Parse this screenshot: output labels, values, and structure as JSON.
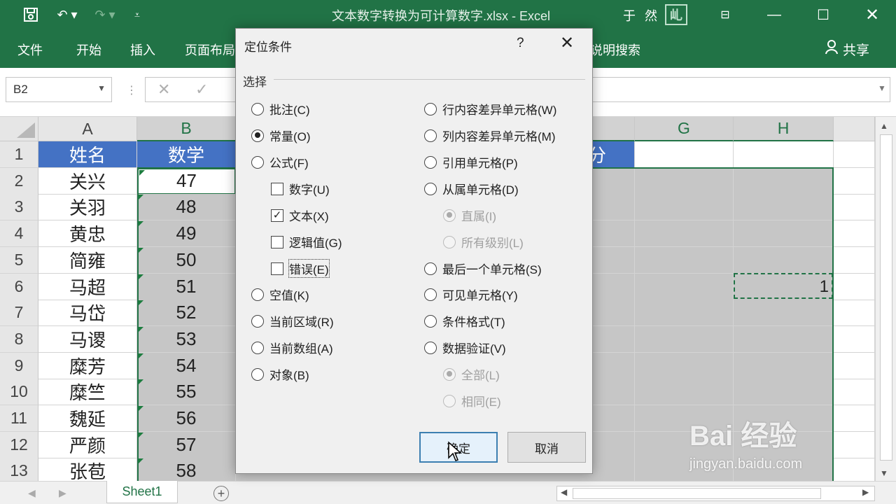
{
  "window": {
    "title": "文本数字转换为可计算数字.xlsx  -  Excel",
    "user": "于 然",
    "user_badge": "乢",
    "icons": [
      "save-icon",
      "undo-icon",
      "redo-icon",
      "customize-icon",
      "ribbon-display-icon",
      "minimize-icon",
      "maximize-icon",
      "close-icon"
    ]
  },
  "ribbon": {
    "tabs": [
      "文件",
      "开始",
      "插入",
      "页面布局"
    ],
    "search_tail": "说明搜索",
    "share_label": "共享"
  },
  "formula_bar": {
    "name_box": "B2",
    "value": ""
  },
  "grid": {
    "column_headers": [
      "A",
      "B",
      "G",
      "H"
    ],
    "row_numbers": [
      "1",
      "2",
      "3",
      "4",
      "5",
      "6",
      "7",
      "8",
      "9",
      "10",
      "11",
      "12",
      "13"
    ],
    "header_row": [
      "姓名",
      "数学"
    ],
    "header_tail": "分",
    "names": [
      "关兴",
      "关羽",
      "黄忠",
      "简雍",
      "马超",
      "马岱",
      "马谡",
      "糜芳",
      "糜竺",
      "魏延",
      "严颜",
      "张苞"
    ],
    "math": [
      "47",
      "48",
      "49",
      "50",
      "51",
      "52",
      "53",
      "54",
      "55",
      "56",
      "57",
      "58"
    ],
    "copied_cell_value": "1"
  },
  "sheet_tabs": {
    "active": "Sheet1"
  },
  "dialog": {
    "title": "定位条件",
    "help": "?",
    "close": "✕",
    "group_label": "选择",
    "left_options": [
      {
        "label": "批注(C)",
        "type": "radio",
        "checked": false
      },
      {
        "label": "常量(O)",
        "type": "radio",
        "checked": true
      },
      {
        "label": "公式(F)",
        "type": "radio",
        "checked": false
      },
      {
        "label": "数字(U)",
        "type": "checkbox",
        "checked": false
      },
      {
        "label": "文本(X)",
        "type": "checkbox",
        "checked": true
      },
      {
        "label": "逻辑值(G)",
        "type": "checkbox",
        "checked": false
      },
      {
        "label": "错误(E)",
        "type": "checkbox",
        "checked": false
      },
      {
        "label": "空值(K)",
        "type": "radio",
        "checked": false
      },
      {
        "label": "当前区域(R)",
        "type": "radio",
        "checked": false
      },
      {
        "label": "当前数组(A)",
        "type": "radio",
        "checked": false
      },
      {
        "label": "对象(B)",
        "type": "radio",
        "checked": false
      }
    ],
    "right_options": [
      {
        "label": "行内容差异单元格(W)",
        "type": "radio",
        "checked": false,
        "disabled": false
      },
      {
        "label": "列内容差异单元格(M)",
        "type": "radio",
        "checked": false,
        "disabled": false
      },
      {
        "label": "引用单元格(P)",
        "type": "radio",
        "checked": false,
        "disabled": false
      },
      {
        "label": "从属单元格(D)",
        "type": "radio",
        "checked": false,
        "disabled": false
      },
      {
        "label": "直属(I)",
        "type": "radio",
        "checked": true,
        "disabled": true
      },
      {
        "label": "所有级别(L)",
        "type": "radio",
        "checked": false,
        "disabled": true
      },
      {
        "label": "最后一个单元格(S)",
        "type": "radio",
        "checked": false,
        "disabled": false
      },
      {
        "label": "可见单元格(Y)",
        "type": "radio",
        "checked": false,
        "disabled": false
      },
      {
        "label": "条件格式(T)",
        "type": "radio",
        "checked": false,
        "disabled": false
      },
      {
        "label": "数据验证(V)",
        "type": "radio",
        "checked": false,
        "disabled": false
      },
      {
        "label": "全部(L)",
        "type": "radio",
        "checked": true,
        "disabled": true
      },
      {
        "label": "相同(E)",
        "type": "radio",
        "checked": false,
        "disabled": true
      }
    ],
    "ok_label": "确定",
    "cancel_label": "取消"
  },
  "watermark": {
    "brand": "Bai 经验",
    "url": "jingyan.baidu.com"
  },
  "colors": {
    "excel_green": "#217346",
    "header_blue": "#4472c4",
    "selection_gray": "#c6c6c6"
  }
}
